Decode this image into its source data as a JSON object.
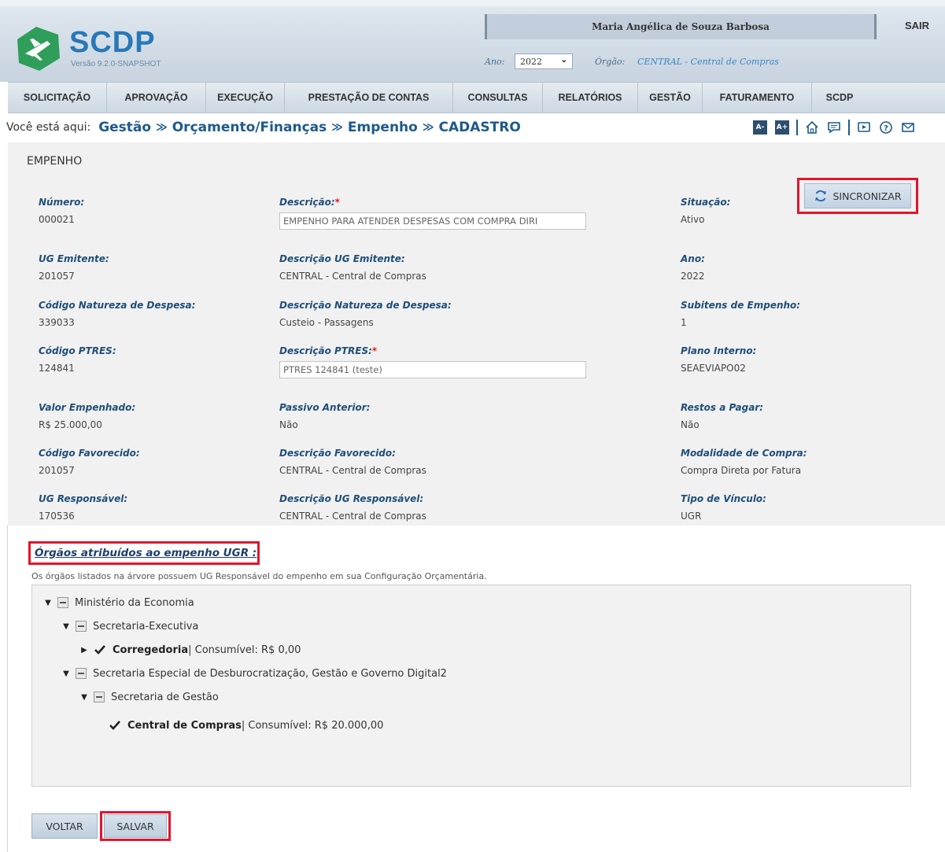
{
  "header": {
    "logo_text": "SCDP",
    "version": "Versão 9.2.0-SNAPSHOT",
    "user_name": "Maria Angélica de Souza Barbosa",
    "logout_label": "SAIR",
    "ano_label": "Ano:",
    "ano_value": "2022",
    "orgao_label": "Órgão:",
    "orgao_value": "CENTRAL - Central de Compras"
  },
  "menu": {
    "items": [
      {
        "label": "SOLICITAÇÃO"
      },
      {
        "label": "APROVAÇÃO"
      },
      {
        "label": "EXECUÇÃO"
      },
      {
        "label": "PRESTAÇÃO DE CONTAS"
      },
      {
        "label": "CONSULTAS"
      },
      {
        "label": "RELATÓRIOS"
      },
      {
        "label": "GESTÃO"
      },
      {
        "label": "FATURAMENTO"
      },
      {
        "label": "SCDP"
      }
    ]
  },
  "breadcrumb": {
    "prefix": "Você está aqui:",
    "items": [
      "Gestão",
      "Orçamento/Finanças",
      "Empenho"
    ],
    "current": "CADASTRO",
    "separator": "≫"
  },
  "toolbar": {
    "font_decrease": "A-",
    "font_increase": "A+",
    "icons": [
      "font-decrease-icon",
      "font-increase-icon",
      "home-icon",
      "chat-icon",
      "video-icon",
      "help-icon",
      "mail-icon"
    ]
  },
  "form": {
    "section_title": "EMPENHO",
    "required_mark": "*",
    "numero": {
      "label": "Número:",
      "value": "000021"
    },
    "descricao": {
      "label": "Descrição:",
      "value": "EMPENHO PARA ATENDER DESPESAS COM COMPRA DIRI"
    },
    "situacao": {
      "label": "Situação:",
      "value": "Ativo"
    },
    "sync_label": "SINCRONIZAR",
    "ug_emitente": {
      "label": "UG Emitente:",
      "value": "201057"
    },
    "desc_ug_emitente": {
      "label": "Descrição UG Emitente:",
      "value": "CENTRAL - Central de Compras"
    },
    "ano": {
      "label": "Ano:",
      "value": "2022"
    },
    "cod_natureza": {
      "label": "Código Natureza de Despesa:",
      "value": "339033"
    },
    "desc_natureza": {
      "label": "Descrição Natureza de Despesa:",
      "value": "Custeio - Passagens"
    },
    "subitens": {
      "label": "Subitens de Empenho:",
      "value": "1"
    },
    "cod_ptres": {
      "label": "Código PTRES:",
      "value": "124841"
    },
    "desc_ptres": {
      "label": "Descrição PTRES:",
      "value": "PTRES 124841 (teste)"
    },
    "plano_interno": {
      "label": "Plano Interno:",
      "value": "SEAEVIAPO02"
    },
    "valor_empenhado": {
      "label": "Valor Empenhado:",
      "value": "R$ 25.000,00"
    },
    "passivo_anterior": {
      "label": "Passivo Anterior:",
      "value": "Não"
    },
    "restos_pagar": {
      "label": "Restos a Pagar:",
      "value": "Não"
    },
    "cod_favorecido": {
      "label": "Código Favorecido:",
      "value": "201057"
    },
    "desc_favorecido": {
      "label": "Descrição Favorecido:",
      "value": "CENTRAL - Central de Compras"
    },
    "modalidade": {
      "label": "Modalidade de Compra:",
      "value": "Compra Direta por Fatura"
    },
    "ug_responsavel": {
      "label": "UG Responsável:",
      "value": "170536"
    },
    "desc_ug_responsavel": {
      "label": "Descrição UG Responsável:",
      "value": "CENTRAL - Central de Compras"
    },
    "tipo_vinculo": {
      "label": "Tipo de Vínculo:",
      "value": "UGR"
    }
  },
  "orgaos": {
    "title": "Órgãos atribuídos ao empenho UGR :",
    "description": "Os órgãos listados na árvore possuem UG Responsável do empenho em sua Configuração Orçamentária.",
    "tree": [
      {
        "label": "Ministério da Economia"
      },
      {
        "label": "Secretaria-Executiva"
      },
      {
        "label": "Corregedoria",
        "extra": " | Consumível: R$ 0,00"
      },
      {
        "label": "Secretaria Especial de Desburocratização, Gestão e Governo Digital2"
      },
      {
        "label": "Secretaria de Gestão"
      },
      {
        "label": "Central de Compras",
        "extra": " | Consumível: R$ 20.000,00"
      }
    ]
  },
  "actions": {
    "voltar": "VOLTAR",
    "salvar": "SALVAR"
  },
  "colors": {
    "accent": "#1f4e79",
    "highlight_red": "#e3142c",
    "required_red": "#e0201d",
    "logo_blue": "#2878b8",
    "logo_green": "#2f9e5a"
  }
}
